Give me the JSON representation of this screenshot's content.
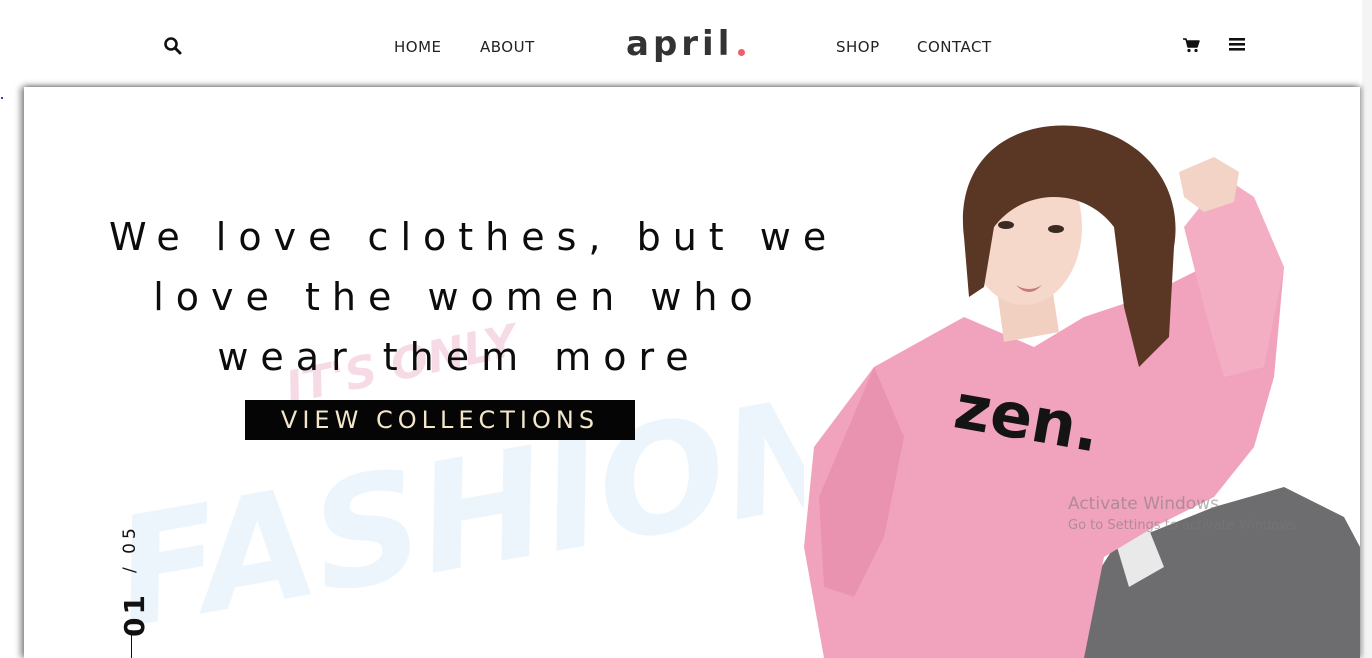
{
  "nav": {
    "home": "HOME",
    "about": "ABOUT",
    "shop": "SHOP",
    "contact": "CONTACT",
    "logo_text": "april",
    "icons": [
      "search-icon",
      "cart-icon",
      "menu-icon"
    ]
  },
  "hero": {
    "headline_lines": [
      "We love clothes, but we",
      "love the women who",
      "wear them more"
    ],
    "cta_label": "VIEW COLLECTIONS",
    "watermark_top": "IT'S ONLY",
    "watermark_main": "FASHION",
    "slide_current": "01",
    "slide_total": "/ 05",
    "sweater_text": "zen."
  },
  "windows_notice": {
    "title": "Activate Windows",
    "subtitle": "Go to Settings to activate Windows."
  },
  "colors": {
    "logo_dot": "#f25c6a",
    "cta_bg": "#050505",
    "cta_text": "#f3e6c9",
    "sweater": "#f1a3bd"
  }
}
